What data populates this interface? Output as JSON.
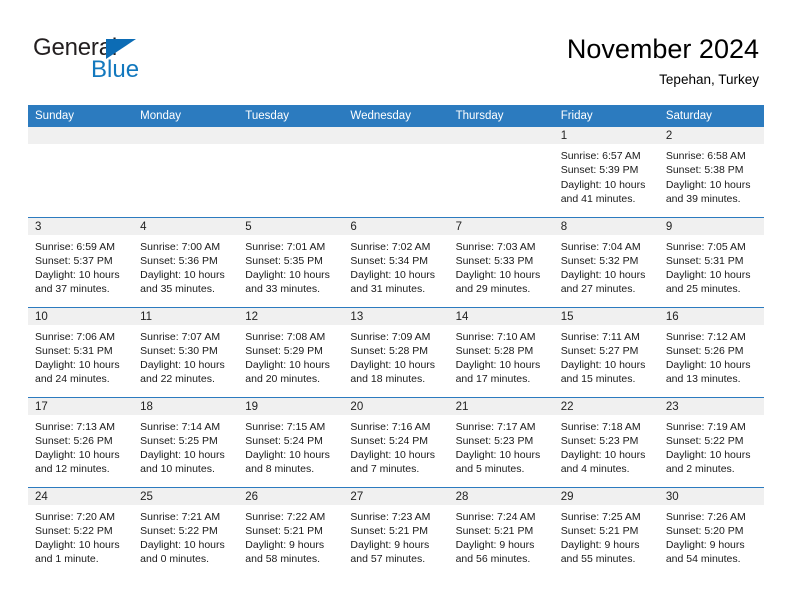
{
  "logo": {
    "primary_text": "General",
    "secondary_text": "Blue",
    "triangle_icon": "blue-triangle-icon",
    "primary_color": "#231f20",
    "secondary_color": "#1278be"
  },
  "header": {
    "title": "November 2024",
    "subtitle": "Tepehan, Turkey"
  },
  "colors": {
    "header_band": "#2c7bbf",
    "daynum_band": "#f0f0f0",
    "grid_line": "#2c7bbf",
    "text": "#1a1a1a"
  },
  "weekday_headers": [
    "Sunday",
    "Monday",
    "Tuesday",
    "Wednesday",
    "Thursday",
    "Friday",
    "Saturday"
  ],
  "labels": {
    "sunrise_prefix": "Sunrise:",
    "sunset_prefix": "Sunset:",
    "daylight_prefix": "Daylight:"
  },
  "weeks": [
    [
      {
        "day": "",
        "empty": true,
        "line1": "",
        "line2": "",
        "line3": "",
        "line4": ""
      },
      {
        "day": "",
        "empty": true,
        "line1": "",
        "line2": "",
        "line3": "",
        "line4": ""
      },
      {
        "day": "",
        "empty": true,
        "line1": "",
        "line2": "",
        "line3": "",
        "line4": ""
      },
      {
        "day": "",
        "empty": true,
        "line1": "",
        "line2": "",
        "line3": "",
        "line4": ""
      },
      {
        "day": "",
        "empty": true,
        "line1": "",
        "line2": "",
        "line3": "",
        "line4": ""
      },
      {
        "day": "1",
        "empty": false,
        "line1": "Sunrise: 6:57 AM",
        "line2": "Sunset: 5:39 PM",
        "line3": "Daylight: 10 hours",
        "line4": "and 41 minutes."
      },
      {
        "day": "2",
        "empty": false,
        "line1": "Sunrise: 6:58 AM",
        "line2": "Sunset: 5:38 PM",
        "line3": "Daylight: 10 hours",
        "line4": "and 39 minutes."
      }
    ],
    [
      {
        "day": "3",
        "empty": false,
        "line1": "Sunrise: 6:59 AM",
        "line2": "Sunset: 5:37 PM",
        "line3": "Daylight: 10 hours",
        "line4": "and 37 minutes."
      },
      {
        "day": "4",
        "empty": false,
        "line1": "Sunrise: 7:00 AM",
        "line2": "Sunset: 5:36 PM",
        "line3": "Daylight: 10 hours",
        "line4": "and 35 minutes."
      },
      {
        "day": "5",
        "empty": false,
        "line1": "Sunrise: 7:01 AM",
        "line2": "Sunset: 5:35 PM",
        "line3": "Daylight: 10 hours",
        "line4": "and 33 minutes."
      },
      {
        "day": "6",
        "empty": false,
        "line1": "Sunrise: 7:02 AM",
        "line2": "Sunset: 5:34 PM",
        "line3": "Daylight: 10 hours",
        "line4": "and 31 minutes."
      },
      {
        "day": "7",
        "empty": false,
        "line1": "Sunrise: 7:03 AM",
        "line2": "Sunset: 5:33 PM",
        "line3": "Daylight: 10 hours",
        "line4": "and 29 minutes."
      },
      {
        "day": "8",
        "empty": false,
        "line1": "Sunrise: 7:04 AM",
        "line2": "Sunset: 5:32 PM",
        "line3": "Daylight: 10 hours",
        "line4": "and 27 minutes."
      },
      {
        "day": "9",
        "empty": false,
        "line1": "Sunrise: 7:05 AM",
        "line2": "Sunset: 5:31 PM",
        "line3": "Daylight: 10 hours",
        "line4": "and 25 minutes."
      }
    ],
    [
      {
        "day": "10",
        "empty": false,
        "line1": "Sunrise: 7:06 AM",
        "line2": "Sunset: 5:31 PM",
        "line3": "Daylight: 10 hours",
        "line4": "and 24 minutes."
      },
      {
        "day": "11",
        "empty": false,
        "line1": "Sunrise: 7:07 AM",
        "line2": "Sunset: 5:30 PM",
        "line3": "Daylight: 10 hours",
        "line4": "and 22 minutes."
      },
      {
        "day": "12",
        "empty": false,
        "line1": "Sunrise: 7:08 AM",
        "line2": "Sunset: 5:29 PM",
        "line3": "Daylight: 10 hours",
        "line4": "and 20 minutes."
      },
      {
        "day": "13",
        "empty": false,
        "line1": "Sunrise: 7:09 AM",
        "line2": "Sunset: 5:28 PM",
        "line3": "Daylight: 10 hours",
        "line4": "and 18 minutes."
      },
      {
        "day": "14",
        "empty": false,
        "line1": "Sunrise: 7:10 AM",
        "line2": "Sunset: 5:28 PM",
        "line3": "Daylight: 10 hours",
        "line4": "and 17 minutes."
      },
      {
        "day": "15",
        "empty": false,
        "line1": "Sunrise: 7:11 AM",
        "line2": "Sunset: 5:27 PM",
        "line3": "Daylight: 10 hours",
        "line4": "and 15 minutes."
      },
      {
        "day": "16",
        "empty": false,
        "line1": "Sunrise: 7:12 AM",
        "line2": "Sunset: 5:26 PM",
        "line3": "Daylight: 10 hours",
        "line4": "and 13 minutes."
      }
    ],
    [
      {
        "day": "17",
        "empty": false,
        "line1": "Sunrise: 7:13 AM",
        "line2": "Sunset: 5:26 PM",
        "line3": "Daylight: 10 hours",
        "line4": "and 12 minutes."
      },
      {
        "day": "18",
        "empty": false,
        "line1": "Sunrise: 7:14 AM",
        "line2": "Sunset: 5:25 PM",
        "line3": "Daylight: 10 hours",
        "line4": "and 10 minutes."
      },
      {
        "day": "19",
        "empty": false,
        "line1": "Sunrise: 7:15 AM",
        "line2": "Sunset: 5:24 PM",
        "line3": "Daylight: 10 hours",
        "line4": "and 8 minutes."
      },
      {
        "day": "20",
        "empty": false,
        "line1": "Sunrise: 7:16 AM",
        "line2": "Sunset: 5:24 PM",
        "line3": "Daylight: 10 hours",
        "line4": "and 7 minutes."
      },
      {
        "day": "21",
        "empty": false,
        "line1": "Sunrise: 7:17 AM",
        "line2": "Sunset: 5:23 PM",
        "line3": "Daylight: 10 hours",
        "line4": "and 5 minutes."
      },
      {
        "day": "22",
        "empty": false,
        "line1": "Sunrise: 7:18 AM",
        "line2": "Sunset: 5:23 PM",
        "line3": "Daylight: 10 hours",
        "line4": "and 4 minutes."
      },
      {
        "day": "23",
        "empty": false,
        "line1": "Sunrise: 7:19 AM",
        "line2": "Sunset: 5:22 PM",
        "line3": "Daylight: 10 hours",
        "line4": "and 2 minutes."
      }
    ],
    [
      {
        "day": "24",
        "empty": false,
        "line1": "Sunrise: 7:20 AM",
        "line2": "Sunset: 5:22 PM",
        "line3": "Daylight: 10 hours",
        "line4": "and 1 minute."
      },
      {
        "day": "25",
        "empty": false,
        "line1": "Sunrise: 7:21 AM",
        "line2": "Sunset: 5:22 PM",
        "line3": "Daylight: 10 hours",
        "line4": "and 0 minutes."
      },
      {
        "day": "26",
        "empty": false,
        "line1": "Sunrise: 7:22 AM",
        "line2": "Sunset: 5:21 PM",
        "line3": "Daylight: 9 hours",
        "line4": "and 58 minutes."
      },
      {
        "day": "27",
        "empty": false,
        "line1": "Sunrise: 7:23 AM",
        "line2": "Sunset: 5:21 PM",
        "line3": "Daylight: 9 hours",
        "line4": "and 57 minutes."
      },
      {
        "day": "28",
        "empty": false,
        "line1": "Sunrise: 7:24 AM",
        "line2": "Sunset: 5:21 PM",
        "line3": "Daylight: 9 hours",
        "line4": "and 56 minutes."
      },
      {
        "day": "29",
        "empty": false,
        "line1": "Sunrise: 7:25 AM",
        "line2": "Sunset: 5:21 PM",
        "line3": "Daylight: 9 hours",
        "line4": "and 55 minutes."
      },
      {
        "day": "30",
        "empty": false,
        "line1": "Sunrise: 7:26 AM",
        "line2": "Sunset: 5:20 PM",
        "line3": "Daylight: 9 hours",
        "line4": "and 54 minutes."
      }
    ]
  ]
}
